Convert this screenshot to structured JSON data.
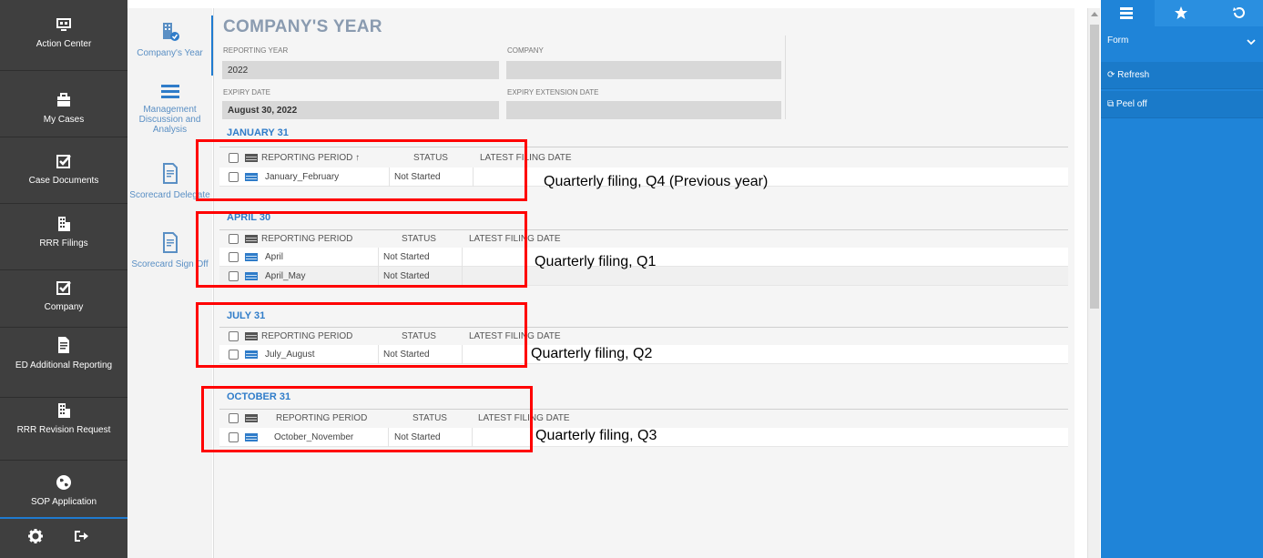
{
  "leftnav": {
    "items": [
      {
        "label": "Action Center",
        "icon": "monitor-icon"
      },
      {
        "label": "My Cases",
        "icon": "briefcase-icon"
      },
      {
        "label": "Case Documents",
        "icon": "checkbox-icon"
      },
      {
        "label": "RRR Filings",
        "icon": "building-icon"
      },
      {
        "label": "Company",
        "icon": "checkbox-icon"
      },
      {
        "label": "ED Additional Reporting",
        "icon": "document-icon"
      },
      {
        "label": "RRR Revision Request",
        "icon": "building-icon"
      },
      {
        "label": "SOP Application",
        "icon": "globe-icon"
      }
    ],
    "bottom": [
      "gear-icon",
      "logout-icon"
    ]
  },
  "subnav": {
    "items": [
      {
        "label": "Company's Year",
        "icon": "building-check-icon",
        "active": true
      },
      {
        "label": "Management Discussion and Analysis",
        "icon": "menu-icon"
      },
      {
        "label": "Scorecard Delegate",
        "icon": "scorecard-icon"
      },
      {
        "label": "Scorecard Sign Off",
        "icon": "scorecard-icon"
      }
    ]
  },
  "main": {
    "title": "COMPANY'S YEAR",
    "fields": {
      "reporting_year_label": "REPORTING YEAR",
      "reporting_year_value": "2022",
      "company_label": "COMPANY",
      "company_value": "",
      "expiry_date_label": "EXPIRY DATE",
      "expiry_date_value": "August 30, 2022",
      "expiry_ext_label": "EXPIRY EXTENSION DATE",
      "expiry_ext_value": ""
    },
    "columns": {
      "period": "REPORTING PERIOD",
      "status": "STATUS",
      "latest": "LATEST FILING DATE"
    },
    "sections": [
      {
        "heading": "JANUARY 31",
        "rows": [
          {
            "period": "January_February",
            "status": "Not Started",
            "latest": ""
          }
        ]
      },
      {
        "heading": "APRIL 30",
        "rows": [
          {
            "period": "April",
            "status": "Not Started",
            "latest": ""
          },
          {
            "period": "April_May",
            "status": "Not Started",
            "latest": ""
          }
        ]
      },
      {
        "heading": "JULY 31",
        "rows": [
          {
            "period": "July_August",
            "status": "Not Started",
            "latest": ""
          }
        ]
      },
      {
        "heading": "OCTOBER 31",
        "rows": [
          {
            "period": "October_November",
            "status": "Not Started",
            "latest": ""
          }
        ]
      }
    ]
  },
  "annotations": [
    "Quarterly filing, Q4 (Previous year)",
    "Quarterly filing, Q1",
    "Quarterly filing, Q2",
    "Quarterly filing, Q3"
  ],
  "rightpanel": {
    "tabs": [
      "layers-icon",
      "star-icon",
      "history-icon"
    ],
    "form_label": "Form",
    "actions": [
      {
        "label": "Refresh",
        "icon": "refresh-icon"
      },
      {
        "label": "Peel off",
        "icon": "peel-off-icon"
      }
    ]
  },
  "colors": {
    "nav_bg": "#3f3f3f",
    "accent": "#1f84d8",
    "annotation_red": "#ff0000",
    "section_blue": "#2f7cc9"
  }
}
